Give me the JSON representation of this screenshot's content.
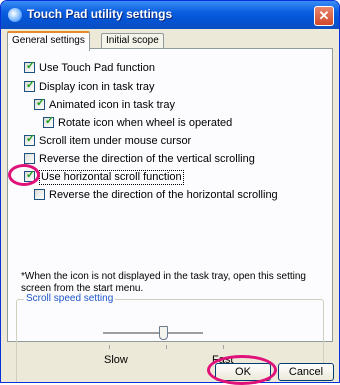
{
  "window": {
    "title": "Touch Pad utility settings",
    "close_glyph": "✕",
    "title_bar_color": "#0a5ee0"
  },
  "tabs": [
    {
      "label": "General settings",
      "selected": true
    },
    {
      "label": "Initial scope",
      "selected": false
    }
  ],
  "options": [
    {
      "label": "Use Touch Pad function",
      "checked": true
    },
    {
      "label": "Display icon in task tray",
      "checked": true
    },
    {
      "label": "Animated icon in task tray",
      "checked": true
    },
    {
      "label": "Rotate icon when wheel is operated",
      "checked": true
    },
    {
      "label": "Scroll item under mouse cursor",
      "checked": true
    },
    {
      "label": "Reverse the direction of the vertical scrolling",
      "checked": false
    },
    {
      "label": "Use horizontal scroll function",
      "checked": true
    },
    {
      "label": "Reverse the direction of the horizontal scrolling",
      "checked": false
    }
  ],
  "check_glyph": "✓",
  "note": "*When the icon is not displayed in the task tray, open this setting screen from the start menu.",
  "scroll_speed": {
    "title": "Scroll speed setting",
    "slow_label": "Slow",
    "fast_label": "Fast",
    "level": 0.6
  },
  "buttons": {
    "ok": "OK",
    "cancel": "Cancel"
  },
  "highlight_color": "#e0127a"
}
